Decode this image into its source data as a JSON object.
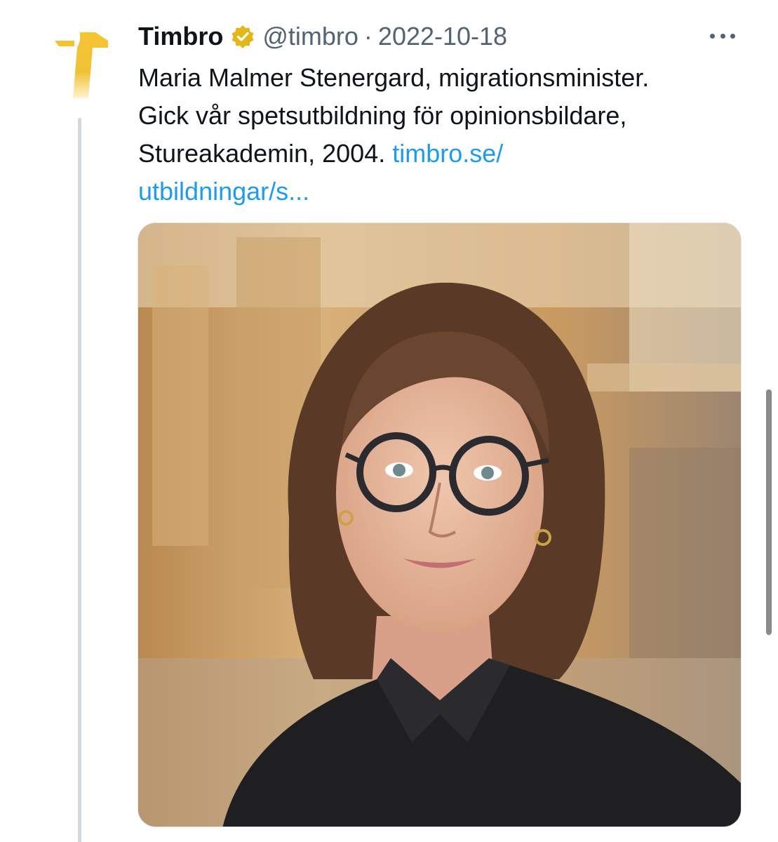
{
  "tweet": {
    "display_name": "Timbro",
    "handle": "@timbro",
    "separator": "·",
    "date": "2022-10-18",
    "text_lines": [
      "Maria Malmer Stenergard, migrationsminister.",
      "Gick vår spetsutbildning för opinionsbildare,",
      "Stureakademin, 2004. "
    ],
    "link_line1": "timbro.se/",
    "link_line2": "utbildningar/s..."
  },
  "icons": {
    "avatar": "timbro-logo-icon",
    "verified": "verified-badge-icon",
    "more": "more-options-icon"
  },
  "colors": {
    "link": "#1d9bf0",
    "secondary_text": "#536471",
    "primary_text": "#0f1419",
    "verified_gold": "#e2b719",
    "logo_gold": "#f2c230"
  }
}
